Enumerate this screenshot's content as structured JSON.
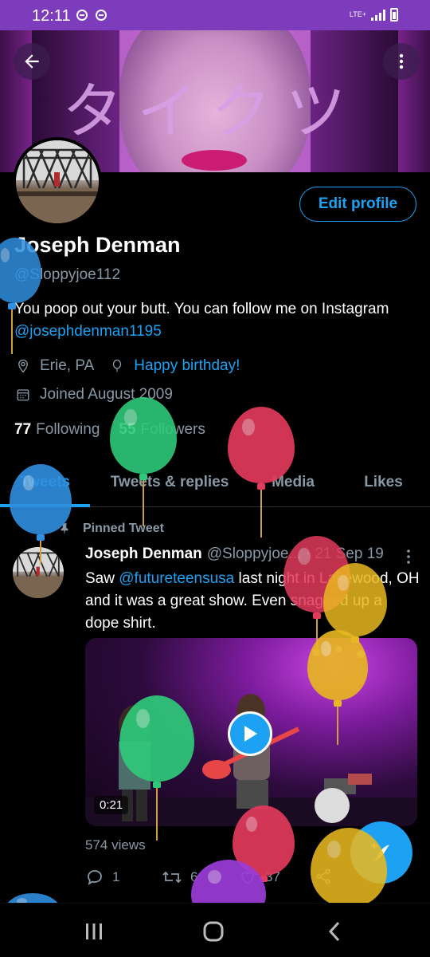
{
  "status_bar": {
    "time": "12:11",
    "network": "LTE+"
  },
  "banner": {
    "kana": "タイクツ"
  },
  "profile": {
    "name": "Joseph Denman",
    "handle": "@Sloppyjoe112",
    "bio_text": "You poop out your butt. You can follow me on Instagram ",
    "bio_link": "@josephdenman1195",
    "location": "Erie, PA",
    "birthday": "Happy birthday!",
    "joined": "Joined August 2009",
    "following_count": "77",
    "following_label": "Following",
    "followers_count": "55",
    "followers_label": "Followers",
    "edit_label": "Edit profile"
  },
  "tabs": [
    {
      "label": "Tweets"
    },
    {
      "label": "Tweets & replies"
    },
    {
      "label": "Media"
    },
    {
      "label": "Likes"
    }
  ],
  "tweet": {
    "pinned_label": "Pinned Tweet",
    "author": "Joseph Denman",
    "handle_date": "@Sloppyjoe... · 21 Sep 19",
    "text_before": "Saw ",
    "mention": "@futureteensusa",
    "text_after": " last night in Lakewood, OH and it was a great show. Even snagged up a dope shirt.",
    "duration": "0:21",
    "views": "574 views",
    "reply_count": "1",
    "retweet_count": "6",
    "like_count": "37"
  },
  "colors": {
    "accent": "#1da1f2",
    "status_bar": "#7d3cbc",
    "background": "#000000",
    "muted": "#8899a6"
  },
  "icons": {
    "back": "arrow-left-icon",
    "overflow": "more-vertical-icon",
    "location": "location-pin-icon",
    "birthday": "balloon-icon",
    "joined": "calendar-icon",
    "pin": "pin-icon",
    "reply": "reply-icon",
    "retweet": "retweet-icon",
    "like": "heart-icon",
    "share": "share-icon",
    "compose": "compose-tweet-icon"
  }
}
